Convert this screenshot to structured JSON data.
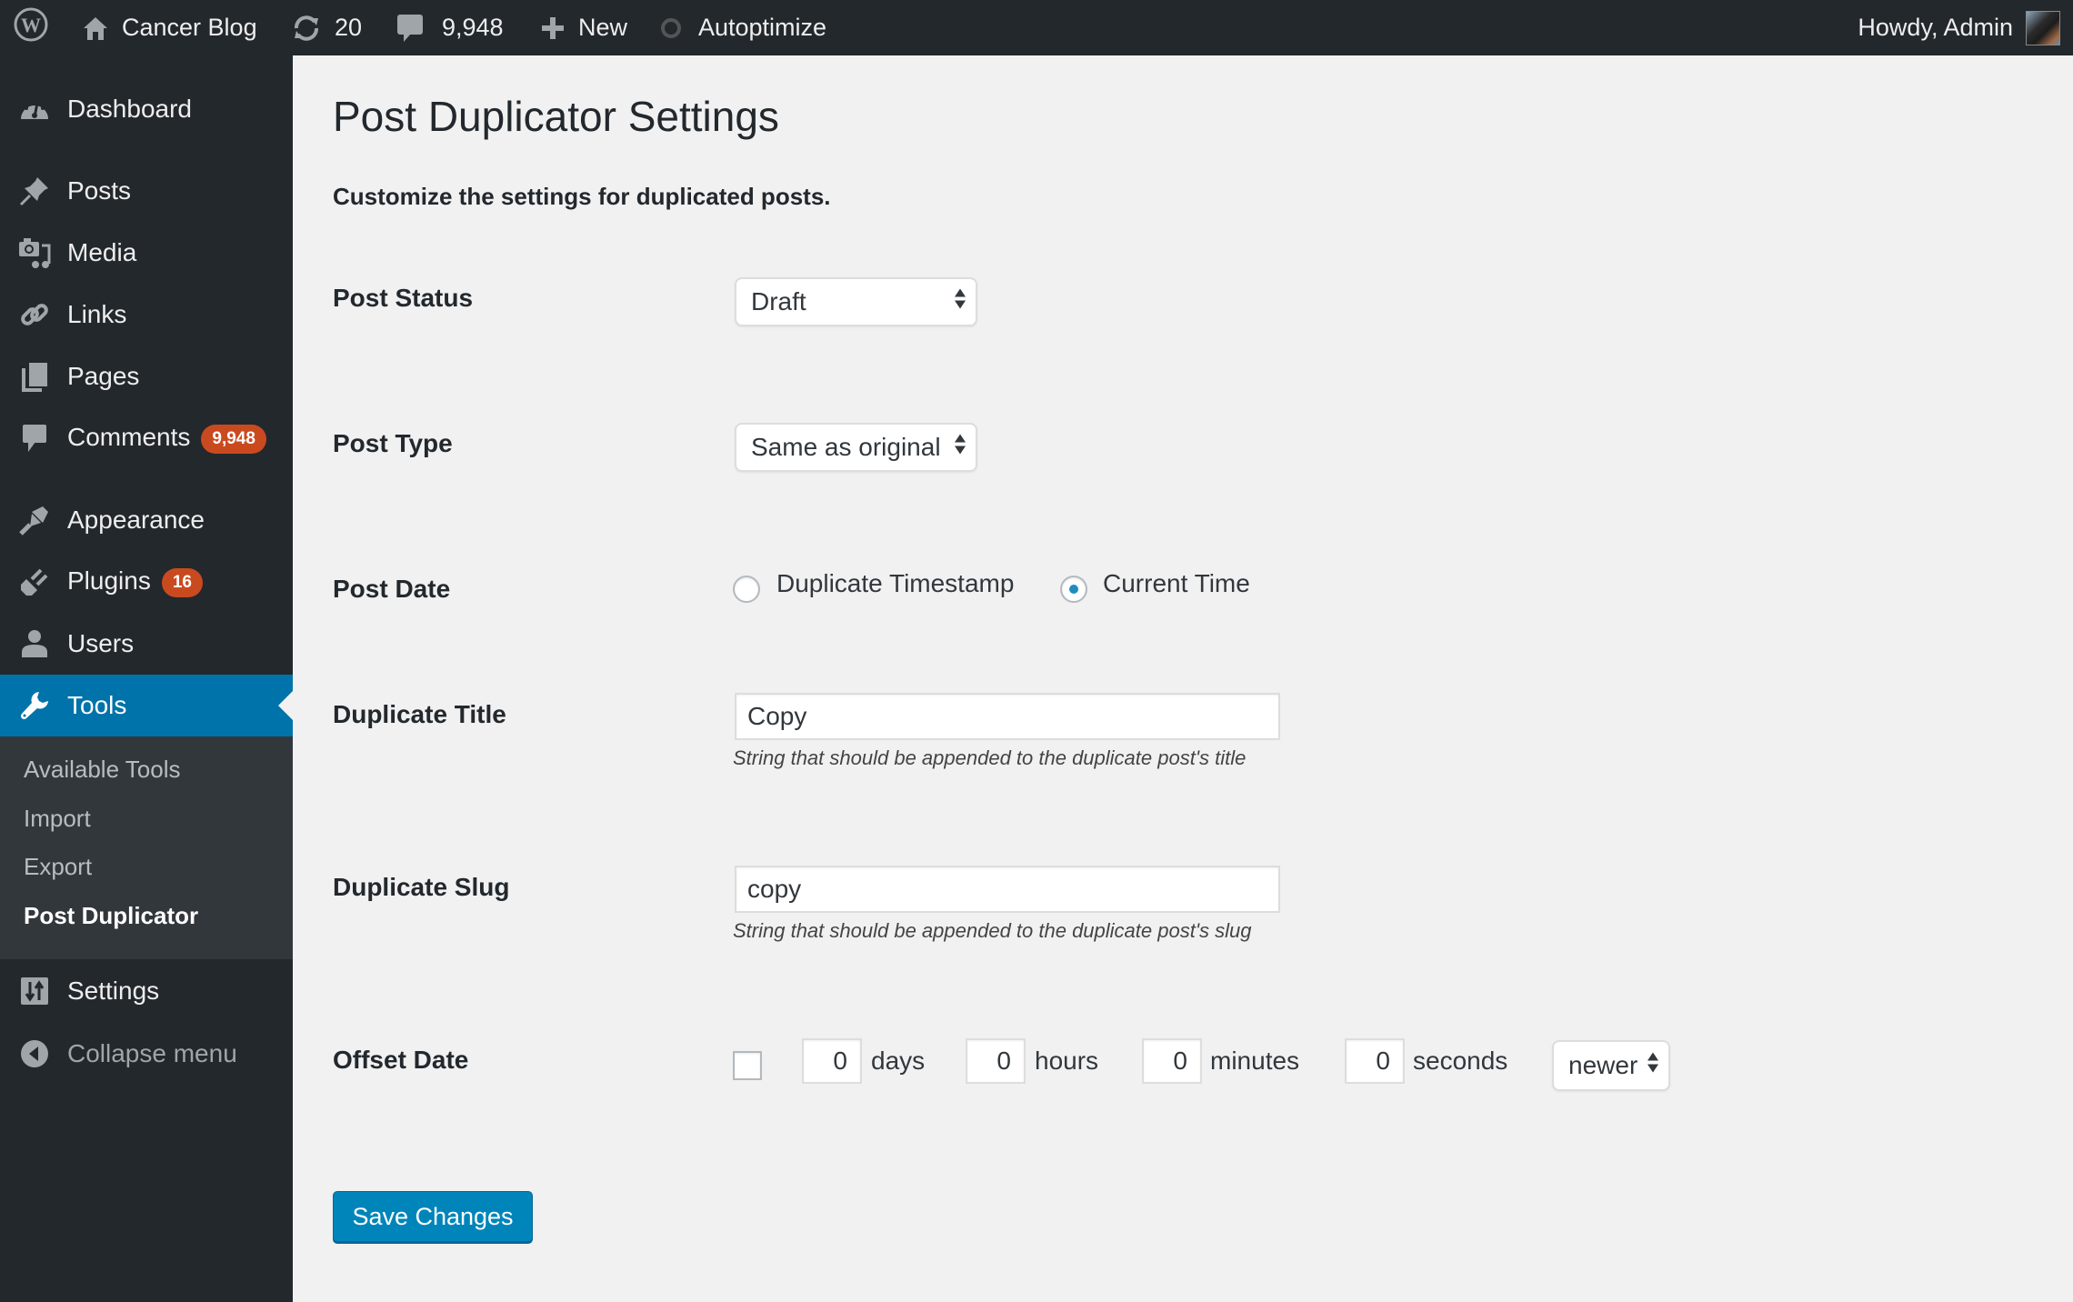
{
  "admin_bar": {
    "site_name": "Cancer Blog",
    "updates_count": "20",
    "comments_count": "9,948",
    "new_label": "New",
    "autoptimize_label": "Autoptimize",
    "greeting": "Howdy, Admin"
  },
  "sidebar": {
    "items": [
      {
        "label": "Dashboard",
        "icon": "dashboard-icon"
      },
      {
        "label": "Posts",
        "icon": "pushpin-icon"
      },
      {
        "label": "Media",
        "icon": "media-icon"
      },
      {
        "label": "Links",
        "icon": "link-icon"
      },
      {
        "label": "Pages",
        "icon": "pages-icon"
      },
      {
        "label": "Comments",
        "icon": "comment-icon",
        "badge": "9,948"
      },
      {
        "label": "Appearance",
        "icon": "paintbrush-icon"
      },
      {
        "label": "Plugins",
        "icon": "plugin-icon",
        "badge": "16"
      },
      {
        "label": "Users",
        "icon": "user-icon"
      },
      {
        "label": "Tools",
        "icon": "wrench-icon",
        "current": true
      },
      {
        "label": "Settings",
        "icon": "settings-icon"
      },
      {
        "label": "Collapse menu",
        "icon": "collapse-icon"
      }
    ],
    "submenu": [
      {
        "label": "Available Tools"
      },
      {
        "label": "Import"
      },
      {
        "label": "Export"
      },
      {
        "label": "Post Duplicator",
        "current": true
      }
    ]
  },
  "page": {
    "title": "Post Duplicator Settings",
    "description": "Customize the settings for duplicated posts.",
    "post_status": {
      "label": "Post Status",
      "value": "Draft"
    },
    "post_type": {
      "label": "Post Type",
      "value": "Same as original"
    },
    "post_date": {
      "label": "Post Date",
      "options": [
        "Duplicate Timestamp",
        "Current Time"
      ],
      "selected": "Current Time"
    },
    "duplicate_title": {
      "label": "Duplicate Title",
      "value": "Copy",
      "help": "String that should be appended to the duplicate post's title"
    },
    "duplicate_slug": {
      "label": "Duplicate Slug",
      "value": "copy",
      "help": "String that should be appended to the duplicate post's slug"
    },
    "offset_date": {
      "label": "Offset Date",
      "enabled": false,
      "days": "0",
      "days_label": "days",
      "hours": "0",
      "hours_label": "hours",
      "minutes": "0",
      "minutes_label": "minutes",
      "seconds": "0",
      "seconds_label": "seconds",
      "direction": "newer"
    },
    "save_label": "Save Changes"
  },
  "colors": {
    "admin_bar_bg": "#23282d",
    "sidebar_bg": "#23282d",
    "submenu_bg": "#32373c",
    "accent": "#0073aa",
    "button": "#0085ba",
    "badge": "#ca4a1f",
    "content_bg": "#f1f1f1"
  }
}
